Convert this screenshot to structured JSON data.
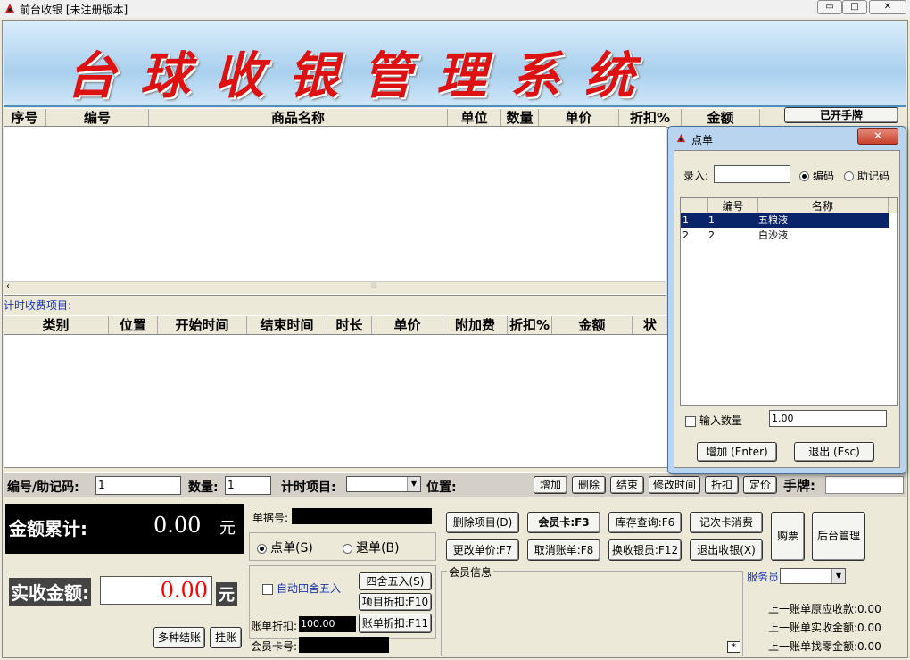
{
  "window": {
    "title": "前台收银 [未注册版本]",
    "min": "▭",
    "max": "□",
    "close": "✕"
  },
  "banner": {
    "text": "台球收银管理系统"
  },
  "goods_grid": {
    "columns": [
      "序号",
      "编号",
      "商品名称",
      "单位",
      "数量",
      "单价",
      "折扣%",
      "金额"
    ]
  },
  "opened_cards_label": "已开手牌",
  "timed_label": "计时收费项目:",
  "timed_grid": {
    "columns": [
      "类别",
      "位置",
      "开始时间",
      "结束时间",
      "时长",
      "单价",
      "附加费",
      "折扣%",
      "金额",
      "状"
    ]
  },
  "entry_bar": {
    "code_label": "编号/助记码:",
    "code_value": "1",
    "qty_label": "数量:",
    "qty_value": "1",
    "timed_item_label": "计时项目:",
    "position_label": "位置:",
    "buttons": [
      "增加",
      "删除",
      "结束",
      "修改时间",
      "折扣",
      "定价"
    ],
    "card_label": "手牌:"
  },
  "totals": {
    "accum_label": "金额累计:",
    "accum_value": "0.00",
    "accum_unit": "元",
    "actual_label": "实收金额:",
    "actual_value": "0.00",
    "actual_unit": "元",
    "multi_pay": "多种结账",
    "credit": "挂账"
  },
  "doc": {
    "number_label": "单据号:",
    "order_label": "点单(S)",
    "return_label": "退单(B)"
  },
  "discount": {
    "auto_round": "自动四舍五入",
    "round_btn": "四舍五入(S)",
    "item_disc_btn": "项目折扣:F10",
    "bill_disc_label": "账单折扣:",
    "bill_disc_value": "100.00",
    "bill_disc_btn": "账单折扣:F11",
    "member_no_label": "会员卡号:"
  },
  "actions": {
    "row1": [
      "删除项目(D)",
      "会员卡:F3",
      "库存查询:F6",
      "记次卡消费"
    ],
    "row2": [
      "更改单价:F7",
      "取消账单:F8",
      "换收银员:F12",
      "退出收银(X)"
    ],
    "buy_ticket": "购票",
    "backoffice": "后台管理"
  },
  "member_info_label": "会员信息",
  "member_star": "*",
  "waiter_label": "服务员",
  "last_bill": [
    {
      "label": "上一账单原应收款:",
      "value": "0.00"
    },
    {
      "label": "上一账单实收金额:",
      "value": "0.00"
    },
    {
      "label": "上一账单找零金额:",
      "value": "0.00"
    }
  ],
  "dialog": {
    "title": "点单",
    "close": "✕",
    "entry_label": "录入:",
    "radio_code": "编码",
    "radio_mnemonic": "助记码",
    "columns": [
      "编号",
      "名称"
    ],
    "rows": [
      {
        "idx": "1",
        "code": "1",
        "name": "五粮液"
      },
      {
        "idx": "2",
        "code": "2",
        "name": "白沙液"
      }
    ],
    "input_qty_label": "输入数量",
    "qty_value": "1.00",
    "add_btn": "增加 (Enter)",
    "exit_btn": "退出 (Esc)"
  },
  "colors": {
    "banner_text": "#d11111",
    "total_text": "#ff0000",
    "selection": "#0a246a"
  }
}
